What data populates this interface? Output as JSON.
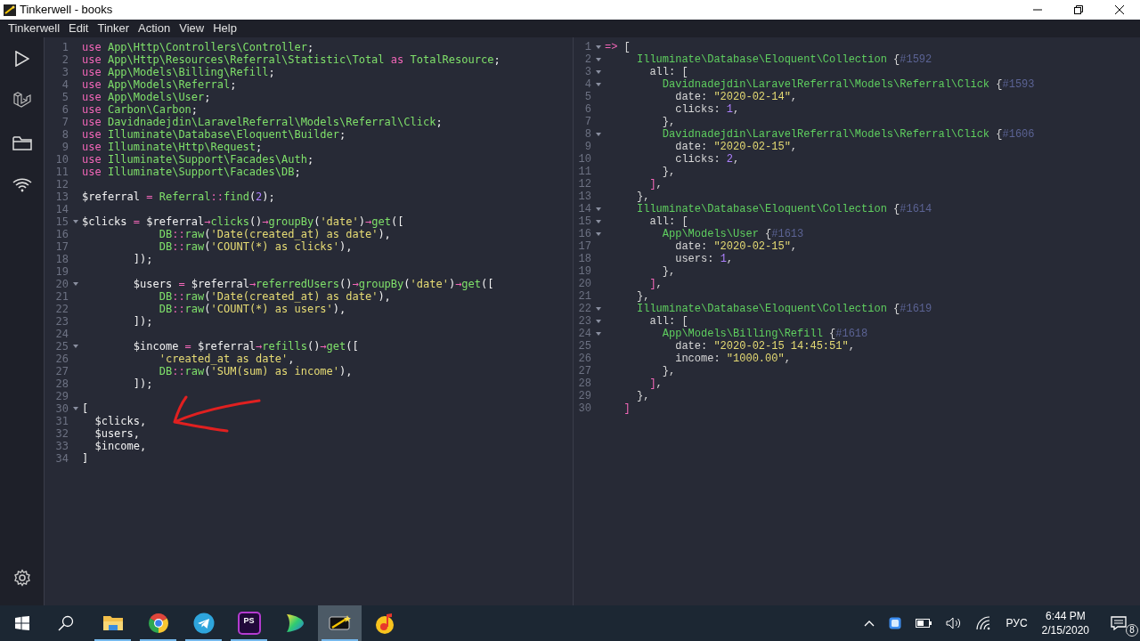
{
  "window": {
    "title": "Tinkerwell - books"
  },
  "menu": [
    "Tinkerwell",
    "Edit",
    "Tinker",
    "Action",
    "View",
    "Help"
  ],
  "editor": {
    "lines": [
      {
        "number": "1",
        "foldable": false,
        "tokens": [
          {
            "kind": "kw",
            "text": "use "
          },
          {
            "kind": "ns",
            "text": "App\\Http\\Controllers\\Controller"
          },
          {
            "kind": "punct",
            "text": ";"
          }
        ]
      },
      {
        "number": "2",
        "foldable": false,
        "tokens": [
          {
            "kind": "kw",
            "text": "use "
          },
          {
            "kind": "ns",
            "text": "App\\Http\\Resources\\Referral\\Statistic\\Total"
          },
          {
            "kind": "kw",
            "text": " as "
          },
          {
            "kind": "ns",
            "text": "TotalResource"
          },
          {
            "kind": "punct",
            "text": ";"
          }
        ]
      },
      {
        "number": "3",
        "foldable": false,
        "tokens": [
          {
            "kind": "kw",
            "text": "use "
          },
          {
            "kind": "ns",
            "text": "App\\Models\\Billing\\Refill"
          },
          {
            "kind": "punct",
            "text": ";"
          }
        ]
      },
      {
        "number": "4",
        "foldable": false,
        "tokens": [
          {
            "kind": "kw",
            "text": "use "
          },
          {
            "kind": "ns",
            "text": "App\\Models\\Referral"
          },
          {
            "kind": "punct",
            "text": ";"
          }
        ]
      },
      {
        "number": "5",
        "foldable": false,
        "tokens": [
          {
            "kind": "kw",
            "text": "use "
          },
          {
            "kind": "ns",
            "text": "App\\Models\\User"
          },
          {
            "kind": "punct",
            "text": ";"
          }
        ]
      },
      {
        "number": "6",
        "foldable": false,
        "tokens": [
          {
            "kind": "kw",
            "text": "use "
          },
          {
            "kind": "ns",
            "text": "Carbon\\Carbon"
          },
          {
            "kind": "punct",
            "text": ";"
          }
        ]
      },
      {
        "number": "7",
        "foldable": false,
        "tokens": [
          {
            "kind": "kw",
            "text": "use "
          },
          {
            "kind": "ns",
            "text": "Davidnadejdin\\LaravelReferral\\Models\\Referral\\Click"
          },
          {
            "kind": "punct",
            "text": ";"
          }
        ]
      },
      {
        "number": "8",
        "foldable": false,
        "tokens": [
          {
            "kind": "kw",
            "text": "use "
          },
          {
            "kind": "ns",
            "text": "Illuminate\\Database\\Eloquent\\Builder"
          },
          {
            "kind": "punct",
            "text": ";"
          }
        ]
      },
      {
        "number": "9",
        "foldable": false,
        "tokens": [
          {
            "kind": "kw",
            "text": "use "
          },
          {
            "kind": "ns",
            "text": "Illuminate\\Http\\Request"
          },
          {
            "kind": "punct",
            "text": ";"
          }
        ]
      },
      {
        "number": "10",
        "foldable": false,
        "tokens": [
          {
            "kind": "kw",
            "text": "use "
          },
          {
            "kind": "ns",
            "text": "Illuminate\\Support\\Facades\\Auth"
          },
          {
            "kind": "punct",
            "text": ";"
          }
        ]
      },
      {
        "number": "11",
        "foldable": false,
        "tokens": [
          {
            "kind": "kw",
            "text": "use "
          },
          {
            "kind": "ns",
            "text": "Illuminate\\Support\\Facades\\DB"
          },
          {
            "kind": "punct",
            "text": ";"
          }
        ]
      },
      {
        "number": "12",
        "foldable": false
      },
      {
        "number": "13",
        "foldable": false,
        "tokens": [
          {
            "kind": "var",
            "text": "$referral"
          },
          {
            "kind": "op",
            "text": " = "
          },
          {
            "kind": "ns",
            "text": "Referral"
          },
          {
            "kind": "op",
            "text": "::"
          },
          {
            "kind": "fn",
            "text": "find"
          },
          {
            "kind": "punct",
            "text": "("
          },
          {
            "kind": "num",
            "text": "2"
          },
          {
            "kind": "punct",
            "text": ");"
          }
        ]
      },
      {
        "number": "14",
        "foldable": false
      },
      {
        "number": "15",
        "foldable": true,
        "tokens": [
          {
            "kind": "var",
            "text": "$clicks"
          },
          {
            "kind": "op",
            "text": " = "
          },
          {
            "kind": "var",
            "text": "$referral"
          },
          {
            "kind": "op",
            "text": "→"
          },
          {
            "kind": "fn",
            "text": "clicks"
          },
          {
            "kind": "punct",
            "text": "()"
          },
          {
            "kind": "op",
            "text": "→"
          },
          {
            "kind": "fn",
            "text": "groupBy"
          },
          {
            "kind": "punct",
            "text": "("
          },
          {
            "kind": "str",
            "text": "'date'"
          },
          {
            "kind": "punct",
            "text": ")"
          },
          {
            "kind": "op",
            "text": "→"
          },
          {
            "kind": "fn",
            "text": "get"
          },
          {
            "kind": "punct",
            "text": "(["
          }
        ]
      },
      {
        "number": "16",
        "foldable": false,
        "tokens": [
          {
            "kind": "ns",
            "text": "            DB"
          },
          {
            "kind": "op",
            "text": "::"
          },
          {
            "kind": "fn",
            "text": "raw"
          },
          {
            "kind": "punct",
            "text": "("
          },
          {
            "kind": "str",
            "text": "'Date(created_at) as date'"
          },
          {
            "kind": "punct",
            "text": "),"
          }
        ]
      },
      {
        "number": "17",
        "foldable": false,
        "tokens": [
          {
            "kind": "ns",
            "text": "            DB"
          },
          {
            "kind": "op",
            "text": "::"
          },
          {
            "kind": "fn",
            "text": "raw"
          },
          {
            "kind": "punct",
            "text": "("
          },
          {
            "kind": "str",
            "text": "'COUNT(*) as clicks'"
          },
          {
            "kind": "punct",
            "text": "),"
          }
        ]
      },
      {
        "number": "18",
        "foldable": false,
        "tokens": [
          {
            "kind": "punct",
            "text": "        ]);"
          }
        ]
      },
      {
        "number": "19",
        "foldable": false
      },
      {
        "number": "20",
        "foldable": true,
        "tokens": [
          {
            "kind": "var",
            "text": "        $users"
          },
          {
            "kind": "op",
            "text": " = "
          },
          {
            "kind": "var",
            "text": "$referral"
          },
          {
            "kind": "op",
            "text": "→"
          },
          {
            "kind": "fn",
            "text": "referredUsers"
          },
          {
            "kind": "punct",
            "text": "()"
          },
          {
            "kind": "op",
            "text": "→"
          },
          {
            "kind": "fn",
            "text": "groupBy"
          },
          {
            "kind": "punct",
            "text": "("
          },
          {
            "kind": "str",
            "text": "'date'"
          },
          {
            "kind": "punct",
            "text": ")"
          },
          {
            "kind": "op",
            "text": "→"
          },
          {
            "kind": "fn",
            "text": "get"
          },
          {
            "kind": "punct",
            "text": "(["
          }
        ]
      },
      {
        "number": "21",
        "foldable": false,
        "tokens": [
          {
            "kind": "ns",
            "text": "            DB"
          },
          {
            "kind": "op",
            "text": "::"
          },
          {
            "kind": "fn",
            "text": "raw"
          },
          {
            "kind": "punct",
            "text": "("
          },
          {
            "kind": "str",
            "text": "'Date(created_at) as date'"
          },
          {
            "kind": "punct",
            "text": "),"
          }
        ]
      },
      {
        "number": "22",
        "foldable": false,
        "tokens": [
          {
            "kind": "ns",
            "text": "            DB"
          },
          {
            "kind": "op",
            "text": "::"
          },
          {
            "kind": "fn",
            "text": "raw"
          },
          {
            "kind": "punct",
            "text": "("
          },
          {
            "kind": "str",
            "text": "'COUNT(*) as users'"
          },
          {
            "kind": "punct",
            "text": "),"
          }
        ]
      },
      {
        "number": "23",
        "foldable": false,
        "tokens": [
          {
            "kind": "punct",
            "text": "        ]);"
          }
        ]
      },
      {
        "number": "24",
        "foldable": false
      },
      {
        "number": "25",
        "foldable": true,
        "tokens": [
          {
            "kind": "var",
            "text": "        $income"
          },
          {
            "kind": "op",
            "text": " = "
          },
          {
            "kind": "var",
            "text": "$referral"
          },
          {
            "kind": "op",
            "text": "→"
          },
          {
            "kind": "fn",
            "text": "refills"
          },
          {
            "kind": "punct",
            "text": "()"
          },
          {
            "kind": "op",
            "text": "→"
          },
          {
            "kind": "fn",
            "text": "get"
          },
          {
            "kind": "punct",
            "text": "(["
          }
        ]
      },
      {
        "number": "26",
        "foldable": false,
        "tokens": [
          {
            "kind": "str",
            "text": "            'created_at as date'"
          },
          {
            "kind": "punct",
            "text": ","
          }
        ]
      },
      {
        "number": "27",
        "foldable": false,
        "tokens": [
          {
            "kind": "ns",
            "text": "            DB"
          },
          {
            "kind": "op",
            "text": "::"
          },
          {
            "kind": "fn",
            "text": "raw"
          },
          {
            "kind": "punct",
            "text": "("
          },
          {
            "kind": "str",
            "text": "'SUM(sum) as income'"
          },
          {
            "kind": "punct",
            "text": "),"
          }
        ]
      },
      {
        "number": "28",
        "foldable": false,
        "tokens": [
          {
            "kind": "punct",
            "text": "        ]);"
          }
        ]
      },
      {
        "number": "29",
        "foldable": false
      },
      {
        "number": "30",
        "foldable": true,
        "tokens": [
          {
            "kind": "punct",
            "text": "["
          }
        ]
      },
      {
        "number": "31",
        "foldable": false,
        "tokens": [
          {
            "kind": "var",
            "text": "  $clicks"
          },
          {
            "kind": "punct",
            "text": ","
          }
        ]
      },
      {
        "number": "32",
        "foldable": false,
        "tokens": [
          {
            "kind": "var",
            "text": "  $users"
          },
          {
            "kind": "punct",
            "text": ","
          }
        ]
      },
      {
        "number": "33",
        "foldable": false,
        "tokens": [
          {
            "kind": "var",
            "text": "  $income"
          },
          {
            "kind": "punct",
            "text": ","
          }
        ]
      },
      {
        "number": "34",
        "foldable": false,
        "tokens": [
          {
            "kind": "punct",
            "text": "]"
          }
        ]
      }
    ]
  },
  "output": {
    "lines": [
      {
        "number": "1",
        "foldable": true,
        "tokens": [
          {
            "kind": "op",
            "text": "=>"
          },
          {
            "kind": "punct",
            "text": " ["
          }
        ]
      },
      {
        "number": "2",
        "foldable": true,
        "tokens": [
          {
            "kind": "ns",
            "text": "     Illuminate\\Database\\Eloquent\\Collection"
          },
          {
            "kind": "punct",
            "text": " {"
          },
          {
            "kind": "id",
            "text": "#1592"
          }
        ]
      },
      {
        "number": "3",
        "foldable": true,
        "tokens": [
          {
            "kind": "punct",
            "text": "       all: ["
          }
        ]
      },
      {
        "number": "4",
        "foldable": true,
        "tokens": [
          {
            "kind": "ns",
            "text": "         Davidnadejdin\\LaravelReferral\\Models\\Referral\\Click"
          },
          {
            "kind": "punct",
            "text": " {"
          },
          {
            "kind": "id",
            "text": "#1593"
          }
        ]
      },
      {
        "number": "5",
        "foldable": false,
        "tokens": [
          {
            "kind": "punct",
            "text": "           date: "
          },
          {
            "kind": "str",
            "text": "\"2020-02-14\""
          },
          {
            "kind": "punct",
            "text": ","
          }
        ]
      },
      {
        "number": "6",
        "foldable": false,
        "tokens": [
          {
            "kind": "punct",
            "text": "           clicks: "
          },
          {
            "kind": "num",
            "text": "1"
          },
          {
            "kind": "punct",
            "text": ","
          }
        ]
      },
      {
        "number": "7",
        "foldable": false,
        "tokens": [
          {
            "kind": "punct",
            "text": "         },"
          }
        ]
      },
      {
        "number": "8",
        "foldable": true,
        "tokens": [
          {
            "kind": "ns",
            "text": "         Davidnadejdin\\LaravelReferral\\Models\\Referral\\Click"
          },
          {
            "kind": "punct",
            "text": " {"
          },
          {
            "kind": "id",
            "text": "#1606"
          }
        ]
      },
      {
        "number": "9",
        "foldable": false,
        "tokens": [
          {
            "kind": "punct",
            "text": "           date: "
          },
          {
            "kind": "str",
            "text": "\"2020-02-15\""
          },
          {
            "kind": "punct",
            "text": ","
          }
        ]
      },
      {
        "number": "10",
        "foldable": false,
        "tokens": [
          {
            "kind": "punct",
            "text": "           clicks: "
          },
          {
            "kind": "num",
            "text": "2"
          },
          {
            "kind": "punct",
            "text": ","
          }
        ]
      },
      {
        "number": "11",
        "foldable": false,
        "tokens": [
          {
            "kind": "punct",
            "text": "         },"
          }
        ]
      },
      {
        "number": "12",
        "foldable": false,
        "tokens": [
          {
            "kind": "op",
            "text": "       ]"
          },
          {
            "kind": "punct",
            "text": ","
          }
        ]
      },
      {
        "number": "13",
        "foldable": false,
        "tokens": [
          {
            "kind": "punct",
            "text": "     },"
          }
        ]
      },
      {
        "number": "14",
        "foldable": true,
        "tokens": [
          {
            "kind": "ns",
            "text": "     Illuminate\\Database\\Eloquent\\Collection"
          },
          {
            "kind": "punct",
            "text": " {"
          },
          {
            "kind": "id",
            "text": "#1614"
          }
        ]
      },
      {
        "number": "15",
        "foldable": true,
        "tokens": [
          {
            "kind": "punct",
            "text": "       all: ["
          }
        ]
      },
      {
        "number": "16",
        "foldable": true,
        "tokens": [
          {
            "kind": "ns",
            "text": "         App\\Models\\User"
          },
          {
            "kind": "punct",
            "text": " {"
          },
          {
            "kind": "id",
            "text": "#1613"
          }
        ]
      },
      {
        "number": "17",
        "foldable": false,
        "tokens": [
          {
            "kind": "punct",
            "text": "           date: "
          },
          {
            "kind": "str",
            "text": "\"2020-02-15\""
          },
          {
            "kind": "punct",
            "text": ","
          }
        ]
      },
      {
        "number": "18",
        "foldable": false,
        "tokens": [
          {
            "kind": "punct",
            "text": "           users: "
          },
          {
            "kind": "num",
            "text": "1"
          },
          {
            "kind": "punct",
            "text": ","
          }
        ]
      },
      {
        "number": "19",
        "foldable": false,
        "tokens": [
          {
            "kind": "punct",
            "text": "         },"
          }
        ]
      },
      {
        "number": "20",
        "foldable": false,
        "tokens": [
          {
            "kind": "op",
            "text": "       ]"
          },
          {
            "kind": "punct",
            "text": ","
          }
        ]
      },
      {
        "number": "21",
        "foldable": false,
        "tokens": [
          {
            "kind": "punct",
            "text": "     },"
          }
        ]
      },
      {
        "number": "22",
        "foldable": true,
        "tokens": [
          {
            "kind": "ns",
            "text": "     Illuminate\\Database\\Eloquent\\Collection"
          },
          {
            "kind": "punct",
            "text": " {"
          },
          {
            "kind": "id",
            "text": "#1619"
          }
        ]
      },
      {
        "number": "23",
        "foldable": true,
        "tokens": [
          {
            "kind": "punct",
            "text": "       all: ["
          }
        ]
      },
      {
        "number": "24",
        "foldable": true,
        "tokens": [
          {
            "kind": "ns",
            "text": "         App\\Models\\Billing\\Refill"
          },
          {
            "kind": "punct",
            "text": " {"
          },
          {
            "kind": "id",
            "text": "#1618"
          }
        ]
      },
      {
        "number": "25",
        "foldable": false,
        "tokens": [
          {
            "kind": "punct",
            "text": "           date: "
          },
          {
            "kind": "str",
            "text": "\"2020-02-15 14:45:51\""
          },
          {
            "kind": "punct",
            "text": ","
          }
        ]
      },
      {
        "number": "26",
        "foldable": false,
        "tokens": [
          {
            "kind": "punct",
            "text": "           income: "
          },
          {
            "kind": "str",
            "text": "\"1000.00\""
          },
          {
            "kind": "punct",
            "text": ","
          }
        ]
      },
      {
        "number": "27",
        "foldable": false,
        "tokens": [
          {
            "kind": "punct",
            "text": "         },"
          }
        ]
      },
      {
        "number": "28",
        "foldable": false,
        "tokens": [
          {
            "kind": "op",
            "text": "       ]"
          },
          {
            "kind": "punct",
            "text": ","
          }
        ]
      },
      {
        "number": "29",
        "foldable": false,
        "tokens": [
          {
            "kind": "punct",
            "text": "     },"
          }
        ]
      },
      {
        "number": "30",
        "foldable": false,
        "tokens": [
          {
            "kind": "op",
            "text": "   ]"
          }
        ]
      }
    ]
  },
  "taskbar": {
    "apps": [
      {
        "kind": "explorer",
        "running": true,
        "selected": false
      },
      {
        "kind": "browser",
        "running": true,
        "selected": false
      },
      {
        "kind": "messenger",
        "running": true,
        "selected": false
      },
      {
        "kind": "ide",
        "label": "PS",
        "running": true,
        "selected": false
      },
      {
        "kind": "leaf",
        "running": false,
        "selected": false
      },
      {
        "kind": "tinkerwell",
        "running": true,
        "selected": true
      },
      {
        "kind": "music",
        "running": false,
        "selected": false
      }
    ],
    "tray": {
      "language": "РУС",
      "time": "6:44 PM",
      "date": "2/15/2020",
      "notifications": "8"
    }
  }
}
